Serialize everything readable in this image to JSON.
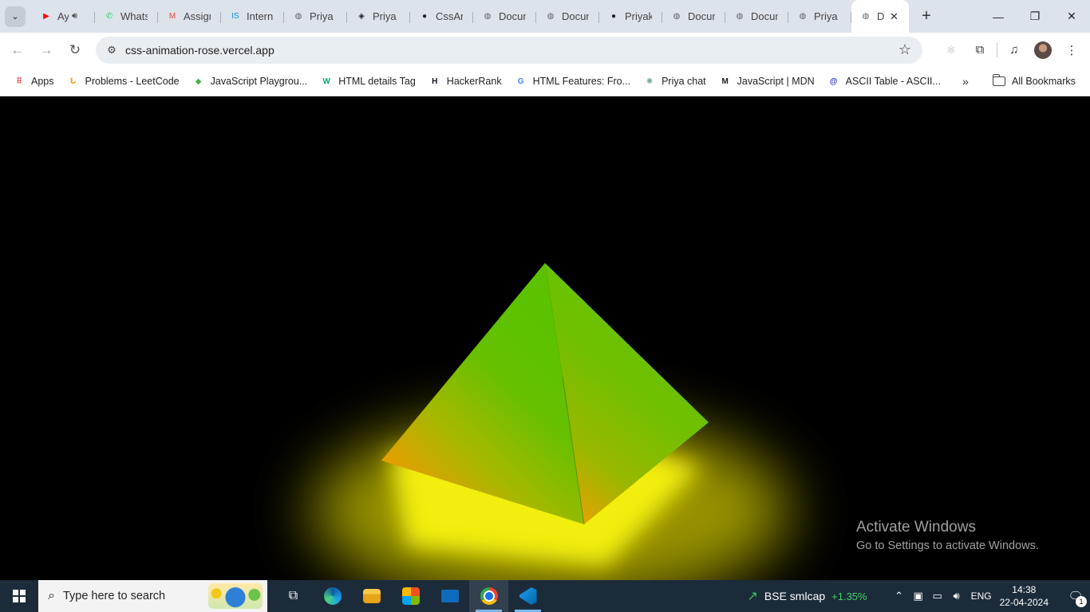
{
  "browser": {
    "tabs": [
      {
        "label": "Ay",
        "favicon": "youtube-icon",
        "color": "#ff0000",
        "glyph": "▶",
        "audio": true
      },
      {
        "label": "Whats",
        "favicon": "whatsapp-icon",
        "color": "#25d366",
        "glyph": "✆"
      },
      {
        "label": "Assign",
        "favicon": "gmail-icon",
        "color": "#ea4335",
        "glyph": "M"
      },
      {
        "label": "Intern",
        "favicon": "internshala-icon",
        "color": "#0b8ee0",
        "glyph": "IS"
      },
      {
        "label": "Priya",
        "favicon": "globe-icon",
        "color": "#5f6368",
        "glyph": "◍"
      },
      {
        "label": "Priya",
        "favicon": "codepen-icon",
        "color": "#1f1f1f",
        "glyph": "◈"
      },
      {
        "label": "CssAn",
        "favicon": "github-icon",
        "color": "#1f1f1f",
        "glyph": "●"
      },
      {
        "label": "Docum",
        "favicon": "globe-icon",
        "color": "#5f6368",
        "glyph": "◍"
      },
      {
        "label": "Docum",
        "favicon": "globe-icon",
        "color": "#5f6368",
        "glyph": "◍"
      },
      {
        "label": "Priyak",
        "favicon": "github-icon",
        "color": "#1f1f1f",
        "glyph": "●"
      },
      {
        "label": "Docum",
        "favicon": "globe-icon",
        "color": "#5f6368",
        "glyph": "◍"
      },
      {
        "label": "Docum",
        "favicon": "globe-icon",
        "color": "#5f6368",
        "glyph": "◍"
      },
      {
        "label": "Priya",
        "favicon": "globe-icon",
        "color": "#5f6368",
        "glyph": "◍"
      }
    ],
    "active_tab": {
      "label": "D",
      "favicon": "globe-icon",
      "close": "✕"
    },
    "new_tab": "+",
    "window_controls": {
      "minimize": "—",
      "restore": "❐",
      "close": "✕"
    },
    "url": "css-animation-rose.vercel.app",
    "bookmarks": [
      {
        "label": "Apps",
        "icon": "apps-grid-icon",
        "color": "#e8453c",
        "glyph": "⠿"
      },
      {
        "label": "Problems - LeetCode",
        "icon": "leetcode-icon",
        "color": "#f89f1b",
        "glyph": "ᒐ"
      },
      {
        "label": "JavaScript Playgrou...",
        "icon": "playground-icon",
        "color": "#4caf50",
        "glyph": "◆"
      },
      {
        "label": "HTML details Tag",
        "icon": "w3schools-icon",
        "color": "#04aa6d",
        "glyph": "W"
      },
      {
        "label": "HackerRank",
        "icon": "hackerrank-icon",
        "color": "#0e141e",
        "glyph": "H"
      },
      {
        "label": "HTML Features: Fro...",
        "icon": "google-icon",
        "color": "#4285f4",
        "glyph": "G"
      },
      {
        "label": "Priya chat",
        "icon": "chatgpt-icon",
        "color": "#74aa9c",
        "glyph": "✺"
      },
      {
        "label": "JavaScript | MDN",
        "icon": "mdn-icon",
        "color": "#1b1b1b",
        "glyph": "M"
      },
      {
        "label": "ASCII Table - ASCII...",
        "icon": "ascii-table-icon",
        "color": "#2a35d8",
        "glyph": "@"
      }
    ],
    "bookmarks_more": "»",
    "all_bookmarks": "All Bookmarks"
  },
  "page": {
    "background": "#000000",
    "pyramid_colors": {
      "green": "#6cc400",
      "orange": "#f0a000",
      "glow": "#f2ee0a"
    }
  },
  "watermark": {
    "title": "Activate Windows",
    "subtitle": "Go to Settings to activate Windows."
  },
  "taskbar": {
    "search_placeholder": "Type here to search",
    "stock_name": "BSE smlcap",
    "stock_change": "+1.35%",
    "language": "ENG",
    "time": "14:38",
    "date": "22-04-2024",
    "notification_count": "1"
  }
}
